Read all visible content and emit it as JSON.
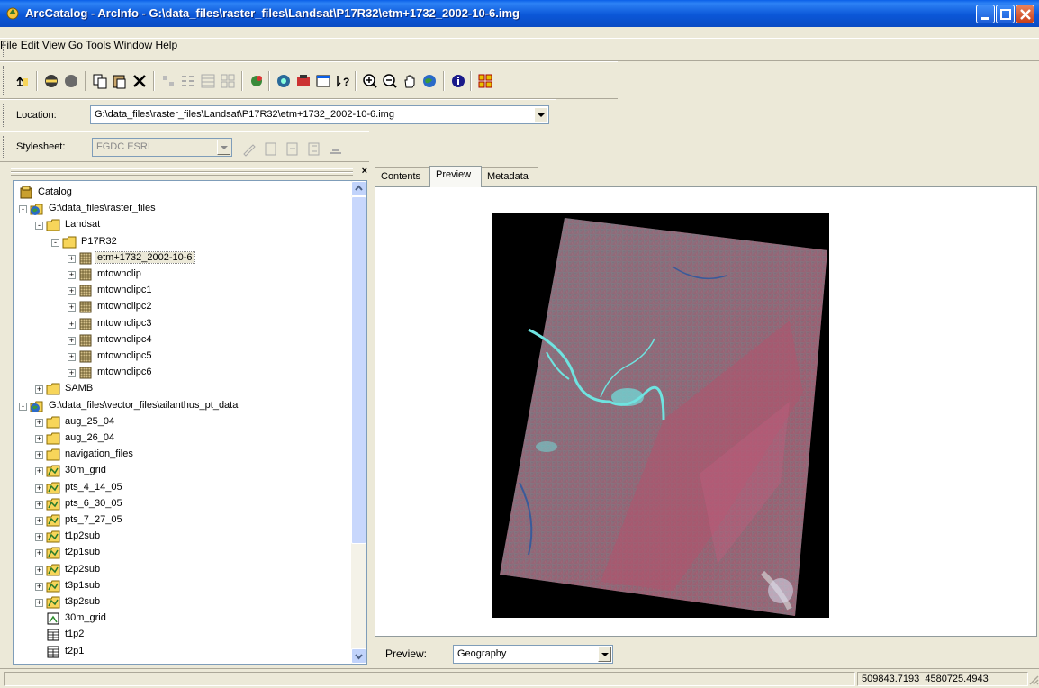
{
  "window": {
    "title": "ArcCatalog - ArcInfo - G:\\data_files\\raster_files\\Landsat\\P17R32\\etm+1732_2002-10-6.img"
  },
  "menu": {
    "items": [
      {
        "label": "File",
        "key": "F",
        "rest": "ile"
      },
      {
        "label": "Edit",
        "key": "E",
        "rest": "dit"
      },
      {
        "label": "View",
        "key": "V",
        "rest": "iew"
      },
      {
        "label": "Go",
        "key": "G",
        "rest": "o"
      },
      {
        "label": "Tools",
        "key": "T",
        "rest": "ools"
      },
      {
        "label": "Window",
        "key": "W",
        "rest": "indow"
      },
      {
        "label": "Help",
        "key": "H",
        "rest": "elp"
      }
    ]
  },
  "location": {
    "label": "Location:",
    "value": "G:\\data_files\\raster_files\\Landsat\\P17R32\\etm+1732_2002-10-6.img"
  },
  "stylesheet": {
    "label": "Stylesheet:",
    "value": "FGDC ESRI"
  },
  "tree": {
    "items": [
      {
        "label": "Catalog",
        "icon": "catalog-icon"
      },
      {
        "label": "G:\\data_files\\raster_files",
        "icon": "folder-connection-icon"
      },
      {
        "label": "Landsat",
        "icon": "folder-icon"
      },
      {
        "label": "P17R32",
        "icon": "folder-icon"
      },
      {
        "label": "etm+1732_2002-10-6",
        "icon": "raster-icon",
        "selected": true
      },
      {
        "label": "mtownclip",
        "icon": "raster-icon"
      },
      {
        "label": "mtownclipc1",
        "icon": "raster-icon"
      },
      {
        "label": "mtownclipc2",
        "icon": "raster-icon"
      },
      {
        "label": "mtownclipc3",
        "icon": "raster-icon"
      },
      {
        "label": "mtownclipc4",
        "icon": "raster-icon"
      },
      {
        "label": "mtownclipc5",
        "icon": "raster-icon"
      },
      {
        "label": "mtownclipc6",
        "icon": "raster-icon"
      },
      {
        "label": "SAMB",
        "icon": "folder-icon"
      },
      {
        "label": "G:\\data_files\\vector_files\\ailanthus_pt_data",
        "icon": "folder-connection-icon"
      },
      {
        "label": "aug_25_04",
        "icon": "folder-icon"
      },
      {
        "label": "aug_26_04",
        "icon": "folder-icon"
      },
      {
        "label": "navigation_files",
        "icon": "folder-icon"
      },
      {
        "label": "30m_grid",
        "icon": "coverage-icon"
      },
      {
        "label": "pts_4_14_05",
        "icon": "coverage-icon"
      },
      {
        "label": "pts_6_30_05",
        "icon": "coverage-icon"
      },
      {
        "label": "pts_7_27_05",
        "icon": "coverage-icon"
      },
      {
        "label": "t1p2sub",
        "icon": "coverage-icon"
      },
      {
        "label": "t2p1sub",
        "icon": "coverage-icon"
      },
      {
        "label": "t2p2sub",
        "icon": "coverage-icon"
      },
      {
        "label": "t3p1sub",
        "icon": "coverage-icon"
      },
      {
        "label": "t3p2sub",
        "icon": "coverage-icon"
      },
      {
        "label": "30m_grid",
        "icon": "grid-icon"
      },
      {
        "label": "t1p2",
        "icon": "table-icon"
      },
      {
        "label": "t2p1",
        "icon": "table-icon"
      }
    ]
  },
  "tabs": [
    {
      "label": "Contents"
    },
    {
      "label": "Preview",
      "active": true
    },
    {
      "label": "Metadata"
    }
  ],
  "preview": {
    "label": "Preview:",
    "mode": "Geography"
  },
  "status": {
    "coordinates": "509843.7193  4580725.4943"
  },
  "colors": {
    "titlebar": "#0A5FE8",
    "chrome": "#ECE9D8",
    "raster_red": "#A05A6E",
    "raster_cyan": "#6FE3E0"
  }
}
